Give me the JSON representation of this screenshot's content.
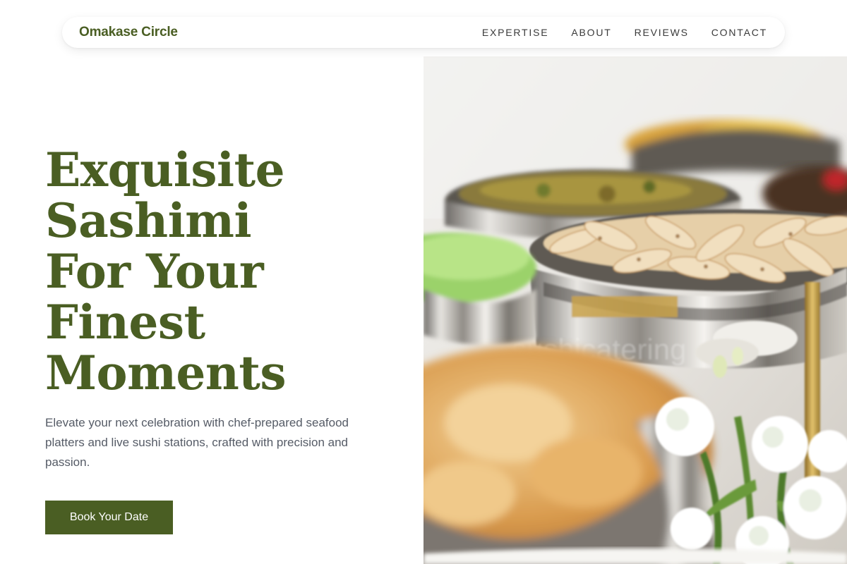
{
  "nav": {
    "brand": "Omakase Circle",
    "links": [
      {
        "label": "EXPERTISE"
      },
      {
        "label": "ABOUT"
      },
      {
        "label": "REVIEWS"
      },
      {
        "label": "CONTACT"
      }
    ]
  },
  "hero": {
    "title_lines": [
      "Exquisite",
      "Sashimi",
      "For Your",
      "Finest",
      "Moments"
    ],
    "description": "Elevate your next celebration with chef-prepared seafood platters and live sushi stations, crafted with precision and passion.",
    "cta_label": "Book Your Date",
    "image_watermark": "sushicatering"
  },
  "colors": {
    "brand_green": "#4a5e23",
    "text_gray": "#555b66",
    "background": "#ffffff"
  }
}
